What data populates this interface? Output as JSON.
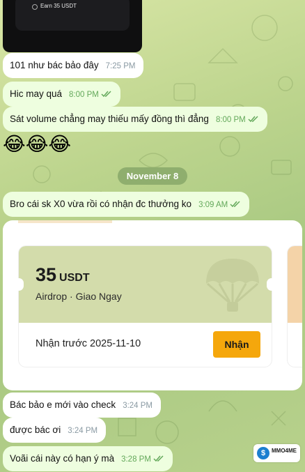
{
  "top_image": {
    "text": "Earn 35 USDT"
  },
  "messages": [
    {
      "text": "101 như bác bảo đây",
      "time": "7:25 PM",
      "dir": "in"
    },
    {
      "text": "Hic may quá",
      "time": "8:00 PM",
      "dir": "out",
      "read": true
    },
    {
      "text": "Sát volume chẳng may thiếu mấy đồng thì đẳng",
      "time": "8:00 PM",
      "dir": "out",
      "read": true
    },
    {
      "text": "😂😂😂",
      "dir": "out"
    },
    {
      "text": "Bro cái sk X0 vừa rồi có nhận đc thưởng ko",
      "time": "3:09 AM",
      "dir": "out",
      "read": true
    },
    {
      "text": "Bác bảo e mới vào check",
      "time": "3:24 PM",
      "dir": "in"
    },
    {
      "text": "được bác ơi",
      "time": "3:24 PM",
      "dir": "in"
    },
    {
      "text": "Voãi cái này có hạn ý mà",
      "time": "3:28 PM",
      "dir": "out",
      "read": true
    }
  ],
  "date_separator": "November 8",
  "coupon": {
    "amount": "35",
    "unit": "USDT",
    "description": "Airdrop · Giao Ngay",
    "deadline": "Nhận trước 2025-11-10",
    "button": "Nhận",
    "icon": "parachute-icon",
    "header_color": "#d3dcab",
    "button_color": "#f5a70c"
  },
  "watermark": {
    "brand": "MMO4ME",
    "logo_icon": "dollar-icon",
    "logo_glyph": "$"
  },
  "colors": {
    "incoming": "#ffffff",
    "outgoing": "#eefedf",
    "accent_check": "#63a85a"
  }
}
